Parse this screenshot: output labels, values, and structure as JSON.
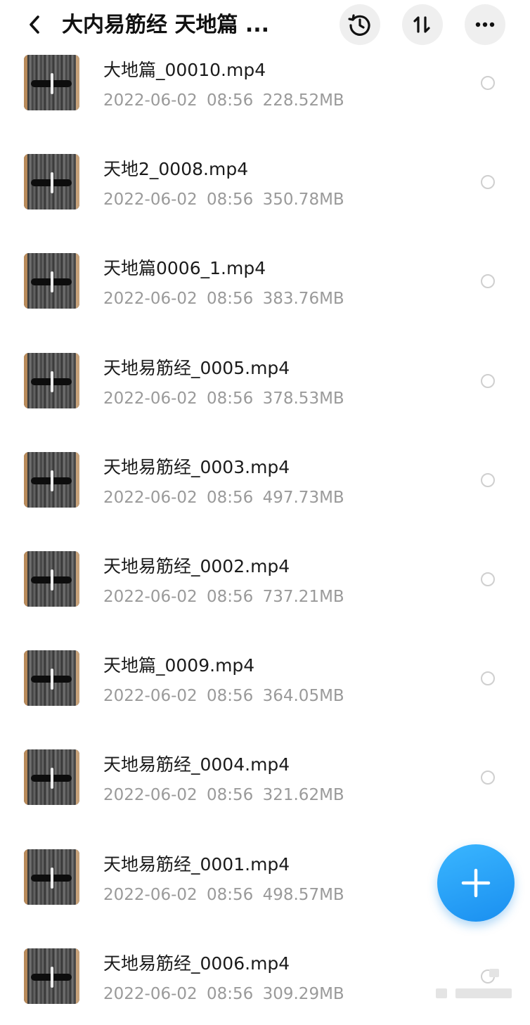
{
  "header": {
    "back_icon": "chevron-left-icon",
    "title": "大内易筋经 天地篇 ...",
    "actions": [
      {
        "name": "history-button",
        "icon": "history-clock-icon"
      },
      {
        "name": "sort-button",
        "icon": "sort-icon"
      },
      {
        "name": "more-button",
        "icon": "more-dots-icon"
      }
    ]
  },
  "files": [
    {
      "name": "大地篇_00010.mp4",
      "date": "2022-06-02",
      "time": "08:56",
      "size": "228.52MB"
    },
    {
      "name": "天地2_0008.mp4",
      "date": "2022-06-02",
      "time": "08:56",
      "size": "350.78MB"
    },
    {
      "name": "天地篇0006_1.mp4",
      "date": "2022-06-02",
      "time": "08:56",
      "size": "383.76MB"
    },
    {
      "name": "天地易筋经_0005.mp4",
      "date": "2022-06-02",
      "time": "08:56",
      "size": "378.53MB"
    },
    {
      "name": "天地易筋经_0003.mp4",
      "date": "2022-06-02",
      "time": "08:56",
      "size": "497.73MB"
    },
    {
      "name": "天地易筋经_0002.mp4",
      "date": "2022-06-02",
      "time": "08:56",
      "size": "737.21MB"
    },
    {
      "name": "天地篇_0009.mp4",
      "date": "2022-06-02",
      "time": "08:56",
      "size": "364.05MB"
    },
    {
      "name": "天地易筋经_0004.mp4",
      "date": "2022-06-02",
      "time": "08:56",
      "size": "321.62MB"
    },
    {
      "name": "天地易筋经_0001.mp4",
      "date": "2022-06-02",
      "time": "08:56",
      "size": "498.57MB"
    },
    {
      "name": "天地易筋经_0006.mp4",
      "date": "2022-06-02",
      "time": "08:56",
      "size": "309.29MB"
    }
  ],
  "fab": {
    "icon": "plus-icon"
  },
  "colors": {
    "accent": "#1e96f5",
    "meta_text": "#9a9a9a"
  }
}
